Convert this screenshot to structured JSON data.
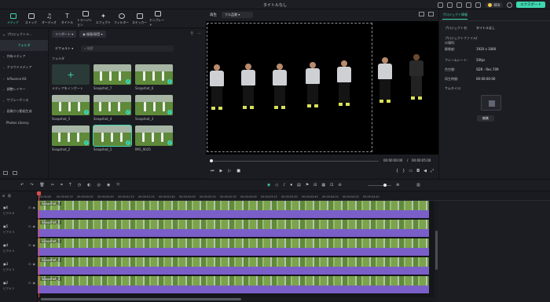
{
  "window": {
    "title": "タイトルなし",
    "credits": "650",
    "export_label": "エクスポート"
  },
  "toolbar": {
    "items": [
      {
        "label": "メディア"
      },
      {
        "label": "ストック"
      },
      {
        "label": "オーディオ"
      },
      {
        "label": "タイトル"
      },
      {
        "label": "トランジション"
      },
      {
        "label": "エフェクト"
      },
      {
        "label": "フィルター"
      },
      {
        "label": "ステッカー"
      },
      {
        "label": "テンプレート"
      }
    ]
  },
  "sidebar": {
    "items": [
      {
        "label": "プロジェクトメ..."
      },
      {
        "label": "フォルダ"
      },
      {
        "label": "共有メディア"
      },
      {
        "label": "クラウドメディア"
      },
      {
        "label": "Influence Kit"
      },
      {
        "label": "調整レイヤー"
      },
      {
        "label": "サブシーケンス"
      },
      {
        "label": "画像から動画生成"
      },
      {
        "label": "Photos Library"
      }
    ]
  },
  "media": {
    "import_label": "インポート",
    "record_label": "録画/録音",
    "default_label": "デフォルト",
    "search_placeholder": "検索",
    "folder_label": "フォルダ",
    "items": [
      {
        "caption": "メディアをインポート"
      },
      {
        "caption": "Snapshot_7"
      },
      {
        "caption": "Snapshot_6"
      },
      {
        "caption": "Snapshot_5"
      },
      {
        "caption": "Snapshot_4"
      },
      {
        "caption": "Snapshot_3"
      },
      {
        "caption": "Snapshot_2"
      },
      {
        "caption": "Snapshot_1"
      },
      {
        "caption": "IMG_9035"
      }
    ]
  },
  "viewer": {
    "label": "再生",
    "quality": "フル品質",
    "current_time": "00:00:00:00",
    "total_time": "00:00:05:00"
  },
  "properties": {
    "tab": "プロジェクト情報",
    "rows": [
      {
        "k": "プロジェクト名:",
        "v": "タイトルなし"
      },
      {
        "k": "プロジェクトファイルの場所:",
        "v": "/"
      },
      {
        "k": "解像度:",
        "v": "1920 x 1080"
      },
      {
        "k": "フレームレート:",
        "v": "50fps"
      },
      {
        "k": "色空間:",
        "v": "SDR - Rec.709"
      },
      {
        "k": "再生時間:",
        "v": "00:00:00:00"
      },
      {
        "k": "サムネイル:",
        "v": ""
      }
    ],
    "edit_label": "編集"
  },
  "timeline": {
    "ruler": [
      "00:00:00",
      "00:00:00:15",
      "00:00:00:30",
      "00:00:00:45",
      "00:00:01:10",
      "00:00:01:25",
      "00:00:01:40",
      "00:00:02:05",
      "00:00:02:20",
      "00:00:02:35",
      "00:00:03:00",
      "00:00:03:15",
      "00:00:03:30",
      "00:00:03:45",
      "00:00:04:10",
      "00:00:04:25",
      "00:00:04:40"
    ],
    "tracks": [
      {
        "name": "ビデオ 6",
        "clip": "Snapshot_7"
      },
      {
        "name": "ビデオ 5",
        "clip": "Snapshot_6"
      },
      {
        "name": "ビデオ 4",
        "clip": "Snapshot_5"
      },
      {
        "name": "ビデオ 3",
        "clip": "Snapshot_4"
      },
      {
        "name": "ビデオ 2",
        "clip": "Snapshot_3"
      }
    ]
  }
}
